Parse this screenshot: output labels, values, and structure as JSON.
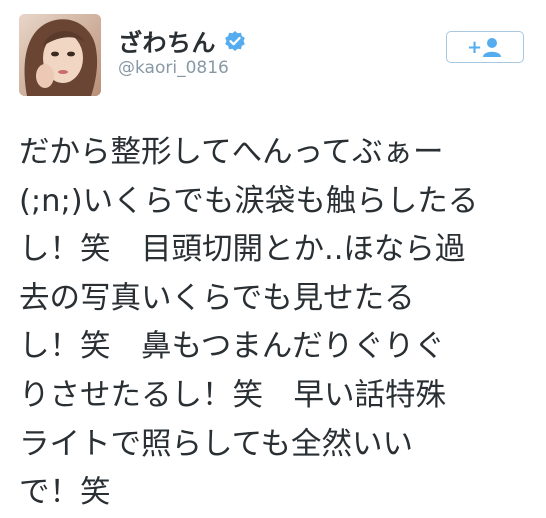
{
  "user": {
    "display_name": "ざわちん",
    "handle": "@kaori_0816",
    "verified": true,
    "avatar_icon": "profile-photo"
  },
  "follow_button": {
    "icon": "follow-user-icon",
    "symbol": "+"
  },
  "tweet": {
    "lines": [
      "だから整形してへんってぶぁー",
      "(;n;)いくらでも涙袋も触らしたる",
      "し！笑　目頭切開とか..ほなら過",
      "去の写真いくらでも見せたる",
      "し！笑　鼻もつまんだりぐりぐ",
      "りさせたるし！笑　早い話特殊",
      "ライトで照らしても全然いい",
      "で！笑"
    ]
  },
  "colors": {
    "text": "#292f33",
    "secondary_text": "#8899a6",
    "verified_blue": "#55acee",
    "button_border": "#a8c8e1",
    "button_icon": "#55acee"
  }
}
